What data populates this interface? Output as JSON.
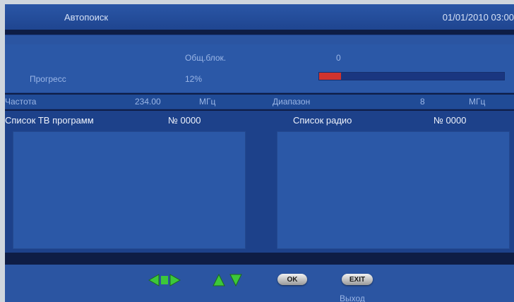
{
  "header": {
    "title": "Автопоиск",
    "datetime": "01/01/2010 03:00"
  },
  "scan": {
    "total_blocks_label": "Общ.блок.",
    "total_blocks_value": "0",
    "progress_label": "Прогресс",
    "progress_text": "12%",
    "progress_fraction": 0.12
  },
  "frequency": {
    "freq_label": "Частота",
    "freq_value": "234.00",
    "freq_unit": "МГц",
    "band_label": "Диапазон",
    "band_value": "8",
    "band_unit": "МГц"
  },
  "lists": {
    "tv_label": "Список ТВ программ",
    "tv_count": "№ 0000",
    "radio_label": "Список радио",
    "radio_count": "№ 0000"
  },
  "footer": {
    "ok_label": "OK",
    "exit_label": "EXIT",
    "exit_caption": "Выход"
  },
  "colors": {
    "background": "#1d418a",
    "panel": "#2b58a7",
    "dark_strip": "#0e1d45",
    "progress_fill": "#d0342e",
    "nav_arrows": "#3cc83a"
  }
}
